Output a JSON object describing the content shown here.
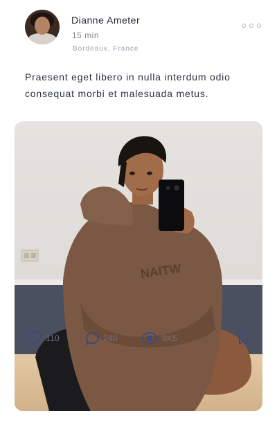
{
  "post": {
    "author": {
      "name": "Dianne Ameter",
      "time_ago": "15 min",
      "location": "Bordeaux, France"
    },
    "caption": "Praesent eget libero in nulla interdum odio consequat morbi et malesuada metus.",
    "media": {
      "hoodie_print": "NAITW"
    },
    "stats": {
      "likes": "110",
      "comments": "240",
      "views": "8K5"
    }
  },
  "icons": {
    "more": "more-horizontal-icon",
    "like": "heart-icon",
    "comment": "comment-bubble-icon",
    "views": "eye-icon",
    "bookmark": "bookmark-icon"
  },
  "colors": {
    "icon_stroke": "#3d4b7a",
    "muted_text": "#7d8799",
    "more_dots": "#a7b4c2"
  }
}
